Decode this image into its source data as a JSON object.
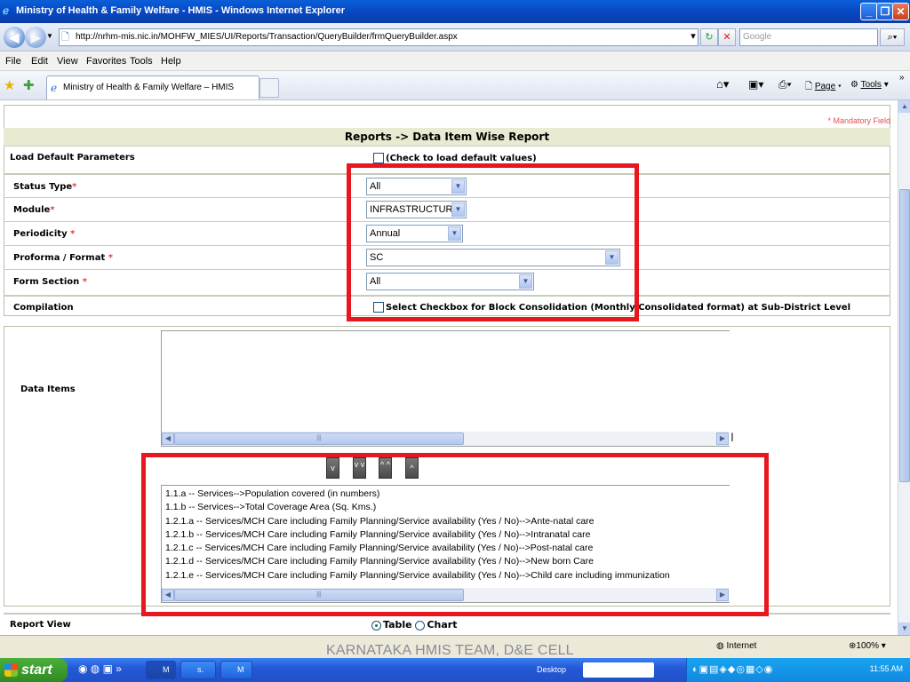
{
  "window": {
    "title": "Ministry of Health & Family Welfare - HMIS - Windows Internet Explorer"
  },
  "address": {
    "url": "http://nrhm-mis.nic.in/MOHFW_MIES/UI/Reports/Transaction/QueryBuilder/frmQueryBuilder.aspx",
    "search_placeholder": "Google"
  },
  "menu": [
    "File",
    "Edit",
    "View",
    "Favorites",
    "Tools",
    "Help"
  ],
  "tab": {
    "label": "Ministry of Health & Family Welfare – HMIS"
  },
  "toolbar_right": {
    "page": "Page",
    "tools": "Tools"
  },
  "form": {
    "mandatory_note": "* Mandatory Field",
    "header": "Reports -> Data Item Wise Report",
    "load_default_label": "Load Default Parameters",
    "load_default_check": "(Check to load default values)",
    "fields": [
      {
        "label": "Status Type",
        "required": "*",
        "value": "All"
      },
      {
        "label": "Module",
        "required": "*",
        "value": "INFRASTRUCTURE"
      },
      {
        "label": "Periodicity",
        "required": "*",
        "value": "Annual"
      },
      {
        "label": "Proforma / Format",
        "required": "*",
        "value": "SC"
      },
      {
        "label": "Form Section",
        "required": "*",
        "value": "All"
      }
    ],
    "compilation_label": "Compilation",
    "compilation_check": "Select Checkbox for Block Consolidation (Monthly Consolidated format) at Sub-District Level",
    "data_items_label": "Data Items",
    "move_buttons": [
      "v",
      "v v",
      "^ ^",
      "^"
    ],
    "data_items": [
      "1.1.a -- Services-->Population covered (in numbers)",
      "1.1.b -- Services-->Total Coverage Area (Sq. Kms.)",
      "1.2.1.a -- Services/MCH Care including Family Planning/Service availability (Yes / No)-->Ante-natal care",
      "1.2.1.b -- Services/MCH Care including Family Planning/Service availability (Yes / No)-->Intranatal care",
      "1.2.1.c -- Services/MCH Care including Family Planning/Service availability (Yes / No)-->Post-natal care",
      "1.2.1.d -- Services/MCH Care including Family Planning/Service availability (Yes / No)-->New born Care",
      "1.2.1.e -- Services/MCH Care including Family Planning/Service availability (Yes / No)-->Child care including immunization"
    ],
    "report_view_label": "Report View",
    "report_view_options": [
      "Table",
      "Chart"
    ],
    "report_view_selected": "Table"
  },
  "statusbar": {
    "zone": "Internet",
    "zoom": "100%",
    "footer": "KARNATAKA HMIS TEAM, D&E CELL"
  },
  "taskbar": {
    "start": "start",
    "buttons": [
      "M",
      "s.",
      "M"
    ],
    "desktop": "Desktop",
    "clock": "11:55 AM"
  },
  "colors": {
    "highlight": "#e8161e",
    "header_bg": "#e9ead2",
    "required": "#e04040"
  }
}
